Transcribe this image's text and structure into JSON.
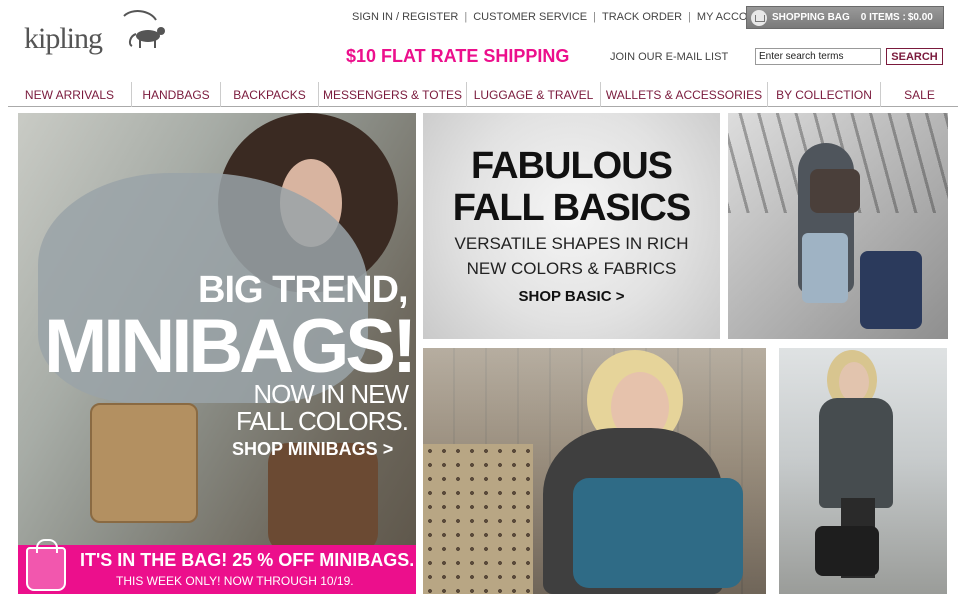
{
  "brand": {
    "name": "kipling"
  },
  "utility_nav": {
    "sign_in": "SIGN IN / REGISTER",
    "customer_service": "CUSTOMER SERVICE",
    "track_order": "TRACK ORDER",
    "my_account": "MY ACCOUNT",
    "separator": "|"
  },
  "cart": {
    "label": "SHOPPING BAG",
    "items": "0 ITEMS :",
    "total": "$0.00"
  },
  "promo_header": {
    "shipping": "$10 FLAT RATE SHIPPING",
    "email_list": "JOIN OUR E-MAIL LIST"
  },
  "search": {
    "value": "Enter search terms",
    "button_label": "SEARCH"
  },
  "main_nav": [
    {
      "label": "NEW ARRIVALS"
    },
    {
      "label": "HANDBAGS"
    },
    {
      "label": "BACKPACKS"
    },
    {
      "label": "MESSENGERS & TOTES"
    },
    {
      "label": "LUGGAGE & TRAVEL"
    },
    {
      "label": "WALLETS & ACCESSORIES"
    },
    {
      "label": "BY COLLECTION"
    },
    {
      "label": "SALE"
    }
  ],
  "hero_left": {
    "headline_1": "BIG TREND,",
    "headline_2": "MINIBAGS!",
    "subline_1": "NOW IN NEW",
    "subline_2": "FALL COLORS.",
    "cta": "SHOP MINIBAGS >",
    "promo_line_1": "IT'S IN THE BAG! 25 % OFF MINIBAGS.",
    "promo_line_2": "THIS WEEK ONLY! NOW THROUGH 10/19."
  },
  "fall_basics": {
    "title_1": "FABULOUS",
    "title_2": "FALL BASICS",
    "sub_1": "VERSATILE SHAPES IN RICH",
    "sub_2": "NEW COLORS & FABRICS",
    "cta": "SHOP BASIC >"
  },
  "colors": {
    "accent_pink": "#ec0f8c",
    "nav_maroon": "#7a1a3c"
  }
}
